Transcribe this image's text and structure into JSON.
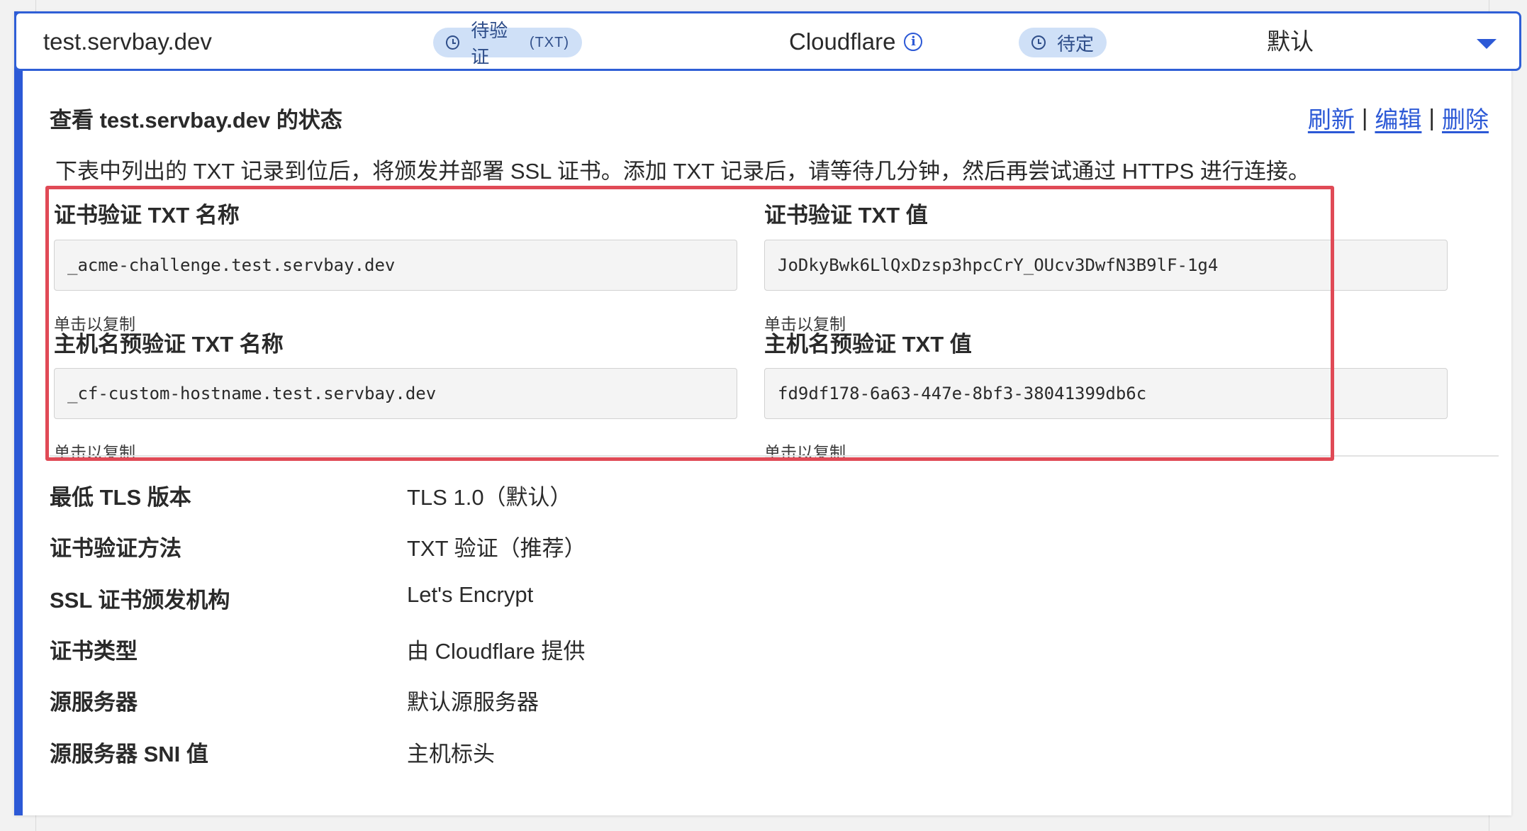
{
  "header": {
    "hostname": "test.servbay.dev",
    "verification_status": "待验证",
    "verification_method_tag": "(TXT)",
    "provider": "Cloudflare",
    "certificate_status": "待定",
    "origin": "默认"
  },
  "status_section": {
    "title": "查看 test.servbay.dev 的状态",
    "actions": {
      "refresh": "刷新",
      "edit": "编辑",
      "delete": "删除",
      "separator": "|"
    },
    "description": "下表中列出的 TXT 记录到位后，将颁发并部署 SSL 证书。添加 TXT 记录后，请等待几分钟，然后再尝试通过 HTTPS 进行连接。"
  },
  "txt_records": {
    "cert_name_label": "证书验证 TXT 名称",
    "cert_name_value": "_acme-challenge.test.servbay.dev",
    "cert_value_label": "证书验证 TXT 值",
    "cert_value_value": "JoDkyBwk6LlQxDzsp3hpcCrY_OUcv3DwfN3B9lF-1g4",
    "host_name_label": "主机名预验证 TXT 名称",
    "host_name_value": "_cf-custom-hostname.test.servbay.dev",
    "host_value_label": "主机名预验证 TXT 值",
    "host_value_value": "fd9df178-6a63-447e-8bf3-38041399db6c",
    "copy_hint": "单击以复制"
  },
  "details": [
    {
      "label": "最低 TLS 版本",
      "value": "TLS 1.0（默认）"
    },
    {
      "label": "证书验证方法",
      "value": "TXT 验证（推荐）"
    },
    {
      "label": "SSL 证书颁发机构",
      "value": "Let's Encrypt"
    },
    {
      "label": "证书类型",
      "value": "由 Cloudflare 提供"
    },
    {
      "label": "源服务器",
      "value": "默认源服务器"
    },
    {
      "label": "源服务器 SNI 值",
      "value": "主机标头"
    }
  ],
  "colors": {
    "accent": "#2c59d6",
    "highlight": "#e04a56",
    "pill_bg": "#cfe0f7"
  },
  "icons": [
    "clock-icon",
    "info-icon",
    "chevron-down-icon"
  ]
}
